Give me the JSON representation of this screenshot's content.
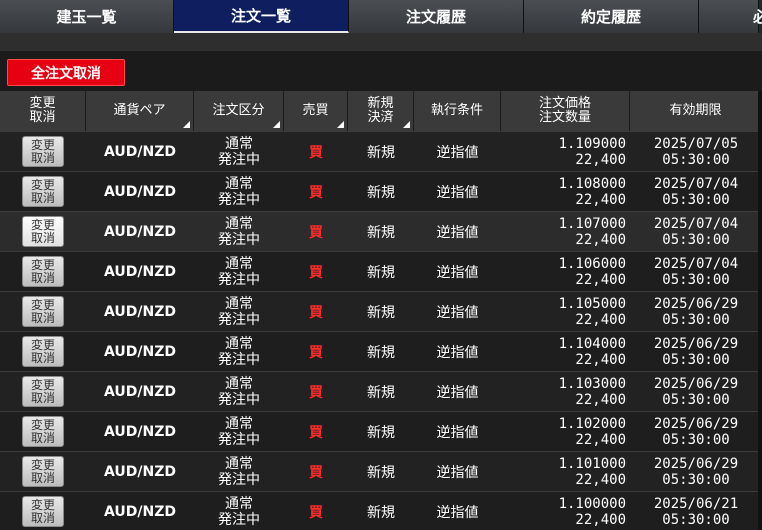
{
  "tabs": [
    {
      "label": "建玉一覧",
      "active": false
    },
    {
      "label": "注文一覧",
      "active": true
    },
    {
      "label": "注文履歴",
      "active": false
    },
    {
      "label": "約定履歴",
      "active": false
    },
    {
      "label": "必",
      "active": false
    }
  ],
  "cancel_all_label": "全注文取消",
  "columns": {
    "modify_cancel": [
      "変更",
      "取消"
    ],
    "pair": "通貨ペア",
    "order_type": "注文区分",
    "side": "売買",
    "open_close": [
      "新規",
      "決済"
    ],
    "exec_condition": "執行条件",
    "price_qty": [
      "注文価格",
      "注文数量"
    ],
    "expiry": "有効期限"
  },
  "rows": [
    {
      "btn": [
        "変更",
        "取消"
      ],
      "pair": "AUD/NZD",
      "type": [
        "通常",
        "発注中"
      ],
      "side": "買",
      "oc": "新規",
      "cond": "逆指値",
      "price": "1.109000",
      "qty": "22,400",
      "date": "2025/07/05",
      "time": "05:30:00"
    },
    {
      "btn": [
        "変更",
        "取消"
      ],
      "pair": "AUD/NZD",
      "type": [
        "通常",
        "発注中"
      ],
      "side": "買",
      "oc": "新規",
      "cond": "逆指値",
      "price": "1.108000",
      "qty": "22,400",
      "date": "2025/07/04",
      "time": "05:30:00"
    },
    {
      "btn": [
        "変更",
        "取消"
      ],
      "pair": "AUD/NZD",
      "type": [
        "通常",
        "発注中"
      ],
      "side": "買",
      "oc": "新規",
      "cond": "逆指値",
      "price": "1.107000",
      "qty": "22,400",
      "date": "2025/07/04",
      "time": "05:30:00"
    },
    {
      "btn": [
        "変更",
        "取消"
      ],
      "pair": "AUD/NZD",
      "type": [
        "通常",
        "発注中"
      ],
      "side": "買",
      "oc": "新規",
      "cond": "逆指値",
      "price": "1.106000",
      "qty": "22,400",
      "date": "2025/07/04",
      "time": "05:30:00"
    },
    {
      "btn": [
        "変更",
        "取消"
      ],
      "pair": "AUD/NZD",
      "type": [
        "通常",
        "発注中"
      ],
      "side": "買",
      "oc": "新規",
      "cond": "逆指値",
      "price": "1.105000",
      "qty": "22,400",
      "date": "2025/06/29",
      "time": "05:30:00"
    },
    {
      "btn": [
        "変更",
        "取消"
      ],
      "pair": "AUD/NZD",
      "type": [
        "通常",
        "発注中"
      ],
      "side": "買",
      "oc": "新規",
      "cond": "逆指値",
      "price": "1.104000",
      "qty": "22,400",
      "date": "2025/06/29",
      "time": "05:30:00"
    },
    {
      "btn": [
        "変更",
        "取消"
      ],
      "pair": "AUD/NZD",
      "type": [
        "通常",
        "発注中"
      ],
      "side": "買",
      "oc": "新規",
      "cond": "逆指値",
      "price": "1.103000",
      "qty": "22,400",
      "date": "2025/06/29",
      "time": "05:30:00"
    },
    {
      "btn": [
        "変更",
        "取消"
      ],
      "pair": "AUD/NZD",
      "type": [
        "通常",
        "発注中"
      ],
      "side": "買",
      "oc": "新規",
      "cond": "逆指値",
      "price": "1.102000",
      "qty": "22,400",
      "date": "2025/06/29",
      "time": "05:30:00"
    },
    {
      "btn": [
        "変更",
        "取消"
      ],
      "pair": "AUD/NZD",
      "type": [
        "通常",
        "発注中"
      ],
      "side": "買",
      "oc": "新規",
      "cond": "逆指値",
      "price": "1.101000",
      "qty": "22,400",
      "date": "2025/06/29",
      "time": "05:30:00"
    },
    {
      "btn": [
        "変更",
        "取消"
      ],
      "pair": "AUD/NZD",
      "type": [
        "通常",
        "発注中"
      ],
      "side": "買",
      "oc": "新規",
      "cond": "逆指値",
      "price": "1.100000",
      "qty": "22,400",
      "date": "2025/06/21",
      "time": "05:30:00"
    }
  ],
  "colors": {
    "accent_red": "#e60012",
    "active_tab": "#0e1e5e",
    "buy": "#ff2a2a"
  }
}
